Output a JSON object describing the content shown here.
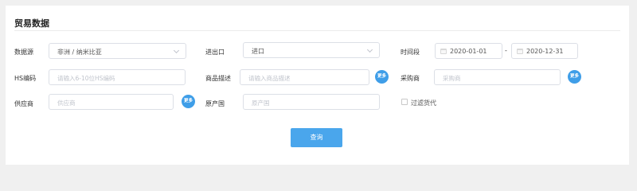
{
  "title": "贸易数据",
  "row1": {
    "data_source": {
      "label": "数据源",
      "value": "非洲 / 纳米比亚"
    },
    "direction": {
      "label": "进出口",
      "value": "进口"
    },
    "period": {
      "label": "时间段",
      "start": "2020-01-01",
      "separator": "-",
      "end": "2020-12-31"
    }
  },
  "row2": {
    "hs_code": {
      "label": "HS编码",
      "placeholder": "请输入6-10位HS编码"
    },
    "product_desc": {
      "label": "商品描述",
      "placeholder": "请输入商品描述",
      "more": "更多"
    },
    "purchaser": {
      "label": "采购商",
      "placeholder": "采购商",
      "more": "更多"
    }
  },
  "row3": {
    "supplier": {
      "label": "供应商",
      "placeholder": "供应商",
      "more": "更多"
    },
    "origin": {
      "label": "原产国",
      "placeholder": "原产国"
    },
    "filter_forwarder": {
      "label": "过滤货代",
      "checked": false
    }
  },
  "query_button": "查询"
}
